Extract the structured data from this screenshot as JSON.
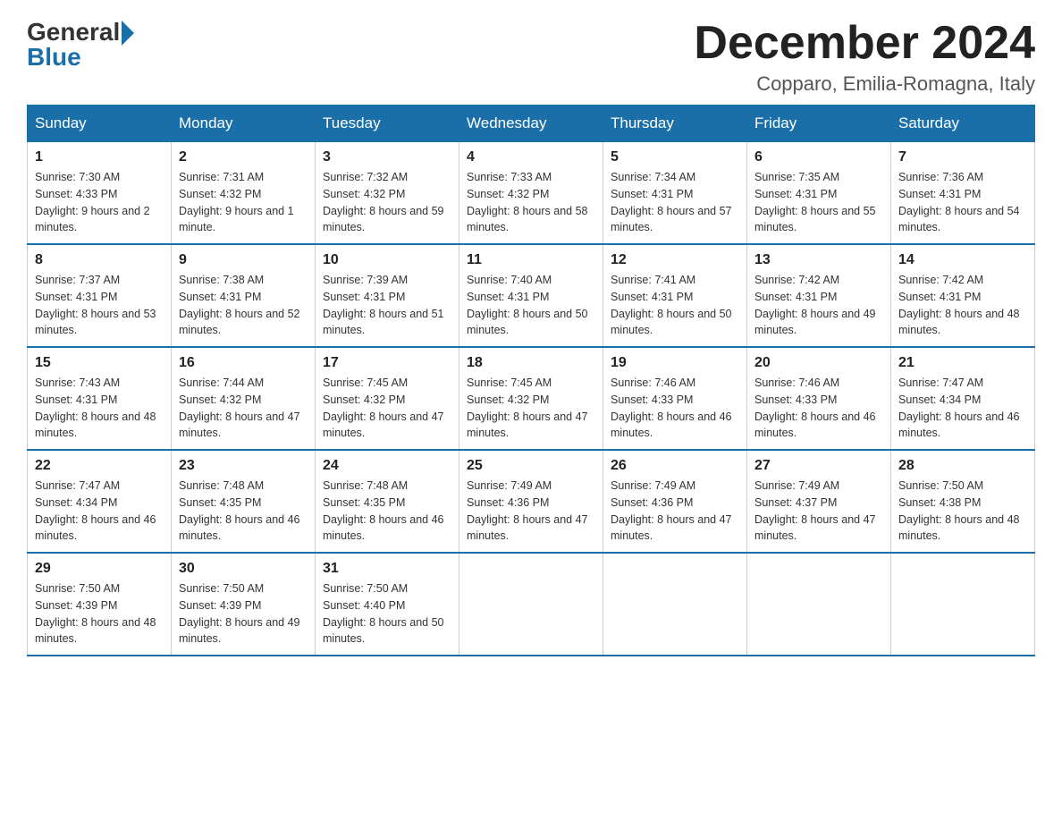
{
  "logo": {
    "general": "General",
    "blue": "Blue"
  },
  "title": "December 2024",
  "subtitle": "Copparo, Emilia-Romagna, Italy",
  "days_of_week": [
    "Sunday",
    "Monday",
    "Tuesday",
    "Wednesday",
    "Thursday",
    "Friday",
    "Saturday"
  ],
  "weeks": [
    [
      {
        "day": "1",
        "sunrise": "7:30 AM",
        "sunset": "4:33 PM",
        "daylight": "9 hours and 2 minutes."
      },
      {
        "day": "2",
        "sunrise": "7:31 AM",
        "sunset": "4:32 PM",
        "daylight": "9 hours and 1 minute."
      },
      {
        "day": "3",
        "sunrise": "7:32 AM",
        "sunset": "4:32 PM",
        "daylight": "8 hours and 59 minutes."
      },
      {
        "day": "4",
        "sunrise": "7:33 AM",
        "sunset": "4:32 PM",
        "daylight": "8 hours and 58 minutes."
      },
      {
        "day": "5",
        "sunrise": "7:34 AM",
        "sunset": "4:31 PM",
        "daylight": "8 hours and 57 minutes."
      },
      {
        "day": "6",
        "sunrise": "7:35 AM",
        "sunset": "4:31 PM",
        "daylight": "8 hours and 55 minutes."
      },
      {
        "day": "7",
        "sunrise": "7:36 AM",
        "sunset": "4:31 PM",
        "daylight": "8 hours and 54 minutes."
      }
    ],
    [
      {
        "day": "8",
        "sunrise": "7:37 AM",
        "sunset": "4:31 PM",
        "daylight": "8 hours and 53 minutes."
      },
      {
        "day": "9",
        "sunrise": "7:38 AM",
        "sunset": "4:31 PM",
        "daylight": "8 hours and 52 minutes."
      },
      {
        "day": "10",
        "sunrise": "7:39 AM",
        "sunset": "4:31 PM",
        "daylight": "8 hours and 51 minutes."
      },
      {
        "day": "11",
        "sunrise": "7:40 AM",
        "sunset": "4:31 PM",
        "daylight": "8 hours and 50 minutes."
      },
      {
        "day": "12",
        "sunrise": "7:41 AM",
        "sunset": "4:31 PM",
        "daylight": "8 hours and 50 minutes."
      },
      {
        "day": "13",
        "sunrise": "7:42 AM",
        "sunset": "4:31 PM",
        "daylight": "8 hours and 49 minutes."
      },
      {
        "day": "14",
        "sunrise": "7:42 AM",
        "sunset": "4:31 PM",
        "daylight": "8 hours and 48 minutes."
      }
    ],
    [
      {
        "day": "15",
        "sunrise": "7:43 AM",
        "sunset": "4:31 PM",
        "daylight": "8 hours and 48 minutes."
      },
      {
        "day": "16",
        "sunrise": "7:44 AM",
        "sunset": "4:32 PM",
        "daylight": "8 hours and 47 minutes."
      },
      {
        "day": "17",
        "sunrise": "7:45 AM",
        "sunset": "4:32 PM",
        "daylight": "8 hours and 47 minutes."
      },
      {
        "day": "18",
        "sunrise": "7:45 AM",
        "sunset": "4:32 PM",
        "daylight": "8 hours and 47 minutes."
      },
      {
        "day": "19",
        "sunrise": "7:46 AM",
        "sunset": "4:33 PM",
        "daylight": "8 hours and 46 minutes."
      },
      {
        "day": "20",
        "sunrise": "7:46 AM",
        "sunset": "4:33 PM",
        "daylight": "8 hours and 46 minutes."
      },
      {
        "day": "21",
        "sunrise": "7:47 AM",
        "sunset": "4:34 PM",
        "daylight": "8 hours and 46 minutes."
      }
    ],
    [
      {
        "day": "22",
        "sunrise": "7:47 AM",
        "sunset": "4:34 PM",
        "daylight": "8 hours and 46 minutes."
      },
      {
        "day": "23",
        "sunrise": "7:48 AM",
        "sunset": "4:35 PM",
        "daylight": "8 hours and 46 minutes."
      },
      {
        "day": "24",
        "sunrise": "7:48 AM",
        "sunset": "4:35 PM",
        "daylight": "8 hours and 46 minutes."
      },
      {
        "day": "25",
        "sunrise": "7:49 AM",
        "sunset": "4:36 PM",
        "daylight": "8 hours and 47 minutes."
      },
      {
        "day": "26",
        "sunrise": "7:49 AM",
        "sunset": "4:36 PM",
        "daylight": "8 hours and 47 minutes."
      },
      {
        "day": "27",
        "sunrise": "7:49 AM",
        "sunset": "4:37 PM",
        "daylight": "8 hours and 47 minutes."
      },
      {
        "day": "28",
        "sunrise": "7:50 AM",
        "sunset": "4:38 PM",
        "daylight": "8 hours and 48 minutes."
      }
    ],
    [
      {
        "day": "29",
        "sunrise": "7:50 AM",
        "sunset": "4:39 PM",
        "daylight": "8 hours and 48 minutes."
      },
      {
        "day": "30",
        "sunrise": "7:50 AM",
        "sunset": "4:39 PM",
        "daylight": "8 hours and 49 minutes."
      },
      {
        "day": "31",
        "sunrise": "7:50 AM",
        "sunset": "4:40 PM",
        "daylight": "8 hours and 50 minutes."
      },
      null,
      null,
      null,
      null
    ]
  ]
}
